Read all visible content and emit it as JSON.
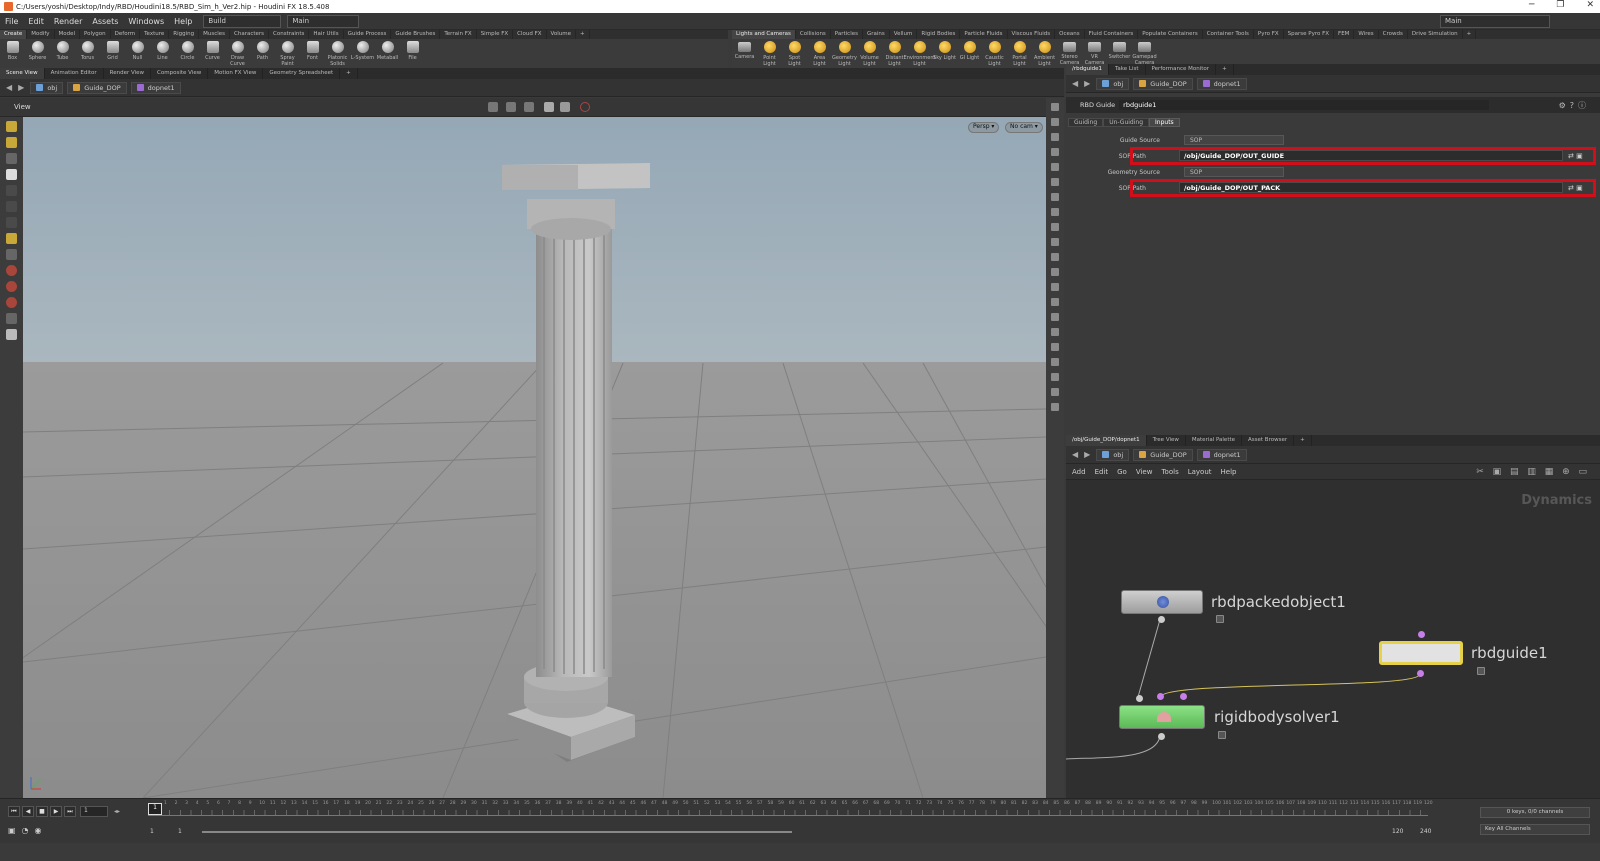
{
  "window": {
    "title": "C:/Users/yoshi/Desktop/Indy/RBD/Houdini18.5/RBD_Sim_h_Ver2.hip - Houdini FX 18.5.408",
    "controls": [
      "─",
      "❐",
      "✕"
    ]
  },
  "menubar": {
    "items": [
      "File",
      "Edit",
      "Render",
      "Assets",
      "Windows",
      "Help"
    ],
    "desktop_select": "Build",
    "context_select": "Main",
    "desktop_right": "Main"
  },
  "shelf_left": {
    "tabs": [
      "Create",
      "Modify",
      "Model",
      "Polygon",
      "Deform",
      "Texture",
      "Rigging",
      "Muscles",
      "Characters",
      "Constraints",
      "Hair Utils",
      "Guide Process",
      "Guide Brushes",
      "Terrain FX",
      "Simple FX",
      "Cloud FX",
      "Volume",
      "+"
    ],
    "tools": [
      "Box",
      "Sphere",
      "Tube",
      "Torus",
      "Grid",
      "Null",
      "Line",
      "Circle",
      "Curve",
      "Draw Curve",
      "Path",
      "Spray Paint",
      "Font",
      "Platonic Solids",
      "L-System",
      "Metaball",
      "File"
    ]
  },
  "shelf_right": {
    "tabs": [
      "Lights and Cameras",
      "Collisions",
      "Particles",
      "Grains",
      "Vellum",
      "Rigid Bodies",
      "Particle Fluids",
      "Viscous Fluids",
      "Oceans",
      "Fluid Containers",
      "Populate Containers",
      "Container Tools",
      "Pyro FX",
      "Sparse Pyro FX",
      "FEM",
      "Wires",
      "Crowds",
      "Drive Simulation",
      "+"
    ],
    "tools": [
      "Camera",
      "Point Light",
      "Spot Light",
      "Area Light",
      "Geometry Light",
      "Volume Light",
      "Distant Light",
      "Environment Light",
      "Sky Light",
      "GI Light",
      "Caustic Light",
      "Portal Light",
      "Ambient Light",
      "Stereo Camera",
      "VR Camera",
      "Switcher",
      "Gamepad Camera"
    ]
  },
  "scene_tabs": [
    "Scene View",
    "Animation Editor",
    "Render View",
    "Composite View",
    "Motion FX View",
    "Geometry Spreadsheet",
    "+"
  ],
  "scene_path": [
    "obj",
    "Guide_DOP",
    "dopnet1"
  ],
  "viewport": {
    "label": "View",
    "persp": "Persp",
    "cam": "No cam"
  },
  "param_tabs": [
    "/rbdguide1",
    "Take List",
    "Performance Monitor",
    "+"
  ],
  "param_path": [
    "obj",
    "Guide_DOP",
    "dopnet1"
  ],
  "params": {
    "node_type": "RBD Guide",
    "node_name": "rbdguide1",
    "tabs": [
      "Guiding",
      "Un-Guiding",
      "Inputs"
    ],
    "active_tab": "Inputs",
    "guide_source_label": "Guide Source",
    "guide_source_value": "SOP",
    "sop_path_label": "SOP Path",
    "sop_path_guide": "/obj/Guide_DOP/OUT_GUIDE",
    "geometry_source_label": "Geometry Source",
    "geometry_source_value": "SOP",
    "sop_path_label2": "SOP Path",
    "sop_path_pack": "/obj/Guide_DOP/OUT_PACK",
    "highlight_color": "#d10f1a"
  },
  "network_tabs": [
    "/obj/Guide_DOP/dopnet1",
    "Tree View",
    "Material Palette",
    "Asset Browser",
    "+"
  ],
  "network_path": [
    "obj",
    "Guide_DOP",
    "dopnet1"
  ],
  "network_menu": [
    "Add",
    "Edit",
    "Go",
    "View",
    "Tools",
    "Layout",
    "Help"
  ],
  "network": {
    "context_label": "Dynamics",
    "nodes": [
      {
        "name": "rbdpackedobject1",
        "color": "#b9b9b9"
      },
      {
        "name": "rbdguide1",
        "color": "#d7d7d7"
      },
      {
        "name": "rigidbodysolver1",
        "color": "#7fd07a"
      }
    ]
  },
  "timeline": {
    "current_frame": "1",
    "start": "1",
    "start2": "1",
    "end": "120",
    "end2": "240",
    "ticks": [
      "1",
      "2",
      "3",
      "4",
      "5",
      "6",
      "7",
      "8",
      "9",
      "10",
      "11",
      "12",
      "13",
      "14",
      "15",
      "16",
      "17",
      "18",
      "19",
      "20",
      "21",
      "22",
      "23",
      "24",
      "25",
      "26",
      "27",
      "28",
      "29",
      "30",
      "31",
      "32",
      "33",
      "34",
      "35",
      "36",
      "37",
      "38",
      "39",
      "40",
      "41",
      "42",
      "43",
      "44",
      "45",
      "46",
      "47",
      "48",
      "49",
      "50",
      "51",
      "52",
      "53",
      "54",
      "55",
      "56",
      "57",
      "58",
      "59",
      "60",
      "61",
      "62",
      "63",
      "64",
      "65",
      "66",
      "67",
      "68",
      "69",
      "70",
      "71",
      "72",
      "73",
      "74",
      "75",
      "76",
      "77",
      "78",
      "79",
      "80",
      "81",
      "82",
      "83",
      "84",
      "85",
      "86",
      "87",
      "88",
      "89",
      "90",
      "91",
      "92",
      "93",
      "94",
      "95",
      "96",
      "97",
      "98",
      "99",
      "100",
      "101",
      "102",
      "103",
      "104",
      "105",
      "106",
      "107",
      "108",
      "109",
      "110",
      "111",
      "112",
      "113",
      "114",
      "115",
      "116",
      "117",
      "118",
      "119",
      "120"
    ],
    "keys_info": "0 keys, 0/0 channels",
    "key_all": "Key All Channels"
  }
}
